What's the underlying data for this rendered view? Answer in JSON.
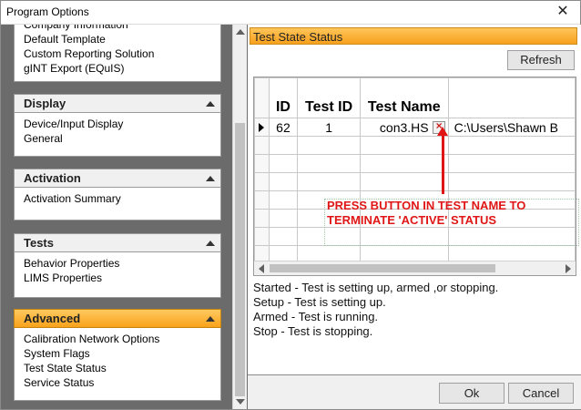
{
  "window": {
    "title": "Program Options",
    "close_glyph": "✕"
  },
  "nav": {
    "groups": [
      {
        "label": "",
        "items": [
          "Company Information",
          "Default Template",
          "Custom Reporting Solution",
          "gINT Export (EQuIS)"
        ]
      },
      {
        "label": "Display",
        "items": [
          "Device/Input Display",
          "General"
        ]
      },
      {
        "label": "Activation",
        "items": [
          "Activation Summary"
        ]
      },
      {
        "label": "Tests",
        "items": [
          "Behavior Properties",
          "LIMS Properties"
        ]
      },
      {
        "label": "Advanced",
        "items": [
          "Calibration Network Options",
          "System Flags",
          "Test State Status",
          "Service Status"
        ],
        "active": true
      }
    ]
  },
  "content": {
    "section_title": "Test State Status",
    "refresh_label": "Refresh",
    "grid": {
      "columns": [
        "ID",
        "Test ID",
        "Test Name",
        ""
      ],
      "rows": [
        {
          "id": "62",
          "test_id": "1",
          "test_name": "con3.HS",
          "path": "C:\\Users\\Shawn B"
        }
      ]
    },
    "annotation": {
      "line1": "PRESS BUTTON IN TEST NAME TO",
      "line2": "TERMINATE 'ACTIVE' STATUS",
      "color": "#e01616"
    },
    "legend": [
      "Started - Test is setting up, armed ,or stopping.",
      "Setup - Test is setting up.",
      "Armed - Test is running.",
      "Stop - Test is stopping."
    ]
  },
  "footer": {
    "ok_label": "Ok",
    "cancel_label": "Cancel"
  },
  "colors": {
    "accent_orange": "#f7a01d",
    "nav_background": "#6b6b6b"
  }
}
